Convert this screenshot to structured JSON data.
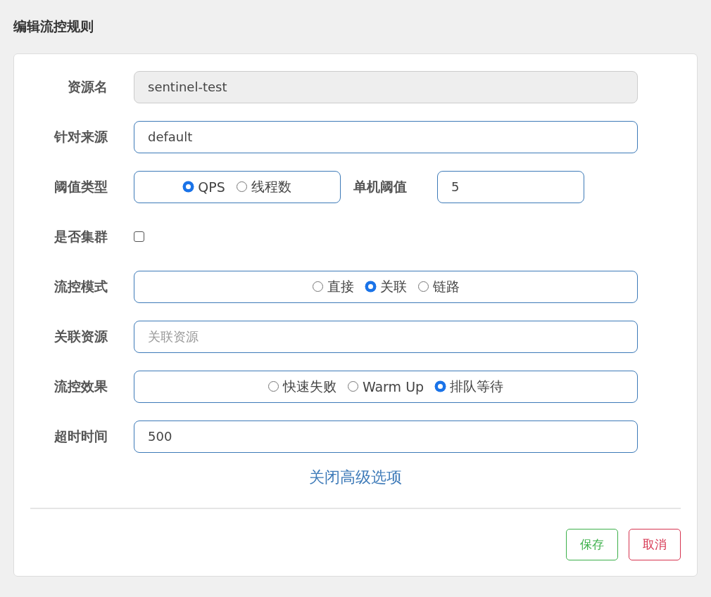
{
  "dialog": {
    "title": "编辑流控规则"
  },
  "fields": [
    {
      "kind": "text",
      "label": "资源名",
      "value": "sentinel-test",
      "disabled": true
    },
    {
      "kind": "text",
      "label": "针对来源",
      "value": "default",
      "disabled": false
    },
    {
      "kind": "radio",
      "label": "阈值类型",
      "options": [
        {
          "label": "QPS",
          "selected": true
        },
        {
          "label": "线程数",
          "selected": false
        }
      ],
      "extra": {
        "label": "单机阈值",
        "value": "5"
      }
    },
    {
      "kind": "checkbox",
      "label": "是否集群",
      "checked": false
    },
    {
      "kind": "radio",
      "label": "流控模式",
      "options": [
        {
          "label": "直接",
          "selected": false
        },
        {
          "label": "关联",
          "selected": true
        },
        {
          "label": "链路",
          "selected": false
        }
      ]
    },
    {
      "kind": "text",
      "label": "关联资源",
      "placeholder": "关联资源",
      "disabled": false
    },
    {
      "kind": "radio",
      "label": "流控效果",
      "options": [
        {
          "label": "快速失败",
          "selected": false
        },
        {
          "label": "Warm Up",
          "selected": false
        },
        {
          "label": "排队等待",
          "selected": true
        }
      ]
    },
    {
      "kind": "text",
      "label": "超时时间",
      "value": "500",
      "disabled": false
    }
  ],
  "advanced_link": "关闭高级选项",
  "buttons": [
    {
      "kind": "save",
      "label": "保存"
    },
    {
      "kind": "cancel",
      "label": "取消"
    }
  ]
}
